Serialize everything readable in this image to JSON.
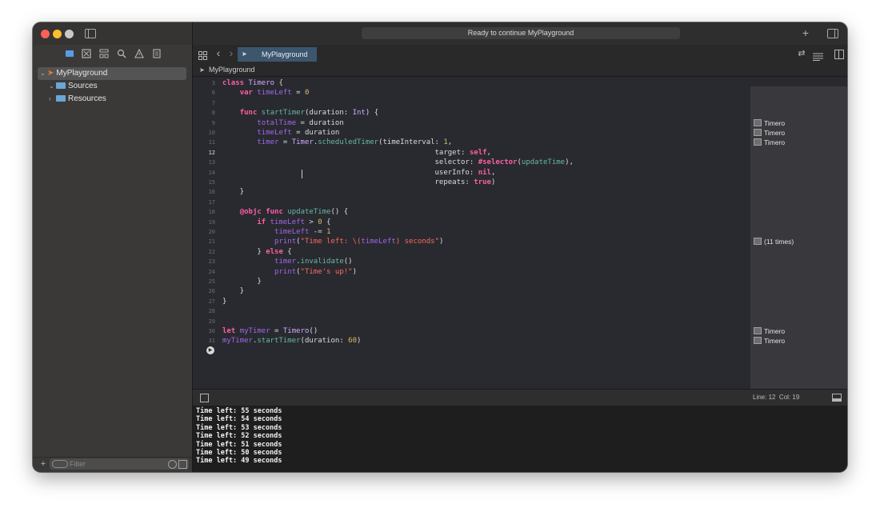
{
  "window": {
    "activity_status": "Ready to continue MyPlayground"
  },
  "sidebar": {
    "tree": [
      {
        "label": "MyPlayground",
        "chevron": "⌄"
      },
      {
        "label": "Sources",
        "chevron": "⌄"
      },
      {
        "label": "Resources",
        "chevron": "›"
      }
    ],
    "filter_placeholder": "Filter"
  },
  "tabbar": {
    "tab_label": "MyPlayground"
  },
  "jumpbar": {
    "file": "MyPlayground"
  },
  "editor": {
    "lines": [
      {
        "n": "3",
        "html": "<span class=\"kw\">class</span> <span class=\"ty\">Timero</span> {"
      },
      {
        "n": "6",
        "html": "    <span class=\"kw\">var</span> <span class=\"pr\">timeLeft</span> = <span class=\"num\">0</span>"
      },
      {
        "n": "7",
        "html": ""
      },
      {
        "n": "8",
        "html": "    <span class=\"kw\">func</span> <span class=\"fn\">startTimer</span>(duration: <span class=\"ty\">Int</span>) {"
      },
      {
        "n": "9",
        "html": "        <span class=\"pr\">totalTime</span> = duration"
      },
      {
        "n": "10",
        "html": "        <span class=\"pr\">timeLeft</span> = duration"
      },
      {
        "n": "11",
        "html": "        <span class=\"pr\">timer</span> = <span class=\"ty\">Timer</span>.<span class=\"fn\">scheduledTimer</span>(timeInterval: <span class=\"num\">1</span>,"
      },
      {
        "n": "12",
        "html": "                                                 target: <span class=\"kw\">self</span>,"
      },
      {
        "n": "13",
        "html": "                                                 selector: <span class=\"kw\">#selector</span>(<span class=\"fn\">updateTime</span>),"
      },
      {
        "n": "14",
        "html": "                                                 userInfo: <span class=\"kw\">nil</span>,"
      },
      {
        "n": "15",
        "html": "                                                 repeats: <span class=\"kw\">true</span>)"
      },
      {
        "n": "16",
        "html": "    }"
      },
      {
        "n": "17",
        "html": ""
      },
      {
        "n": "18",
        "html": "    <span class=\"kw\">@objc</span> <span class=\"kw\">func</span> <span class=\"fn\">updateTime</span>() {"
      },
      {
        "n": "19",
        "html": "        <span class=\"kw\">if</span> <span class=\"pr\">timeLeft</span> &gt; <span class=\"num\">0</span> {"
      },
      {
        "n": "20",
        "html": "            <span class=\"pr\">timeLeft</span> -= <span class=\"num\">1</span>"
      },
      {
        "n": "21",
        "html": "            <span class=\"pr\">print</span>(<span class=\"str\">\"Time left: \\(</span><span class=\"pr\">timeLeft</span><span class=\"str\">) seconds\"</span>)"
      },
      {
        "n": "22",
        "html": "        } <span class=\"kw\">else</span> {"
      },
      {
        "n": "23",
        "html": "            <span class=\"pr\">timer</span>.<span class=\"fn\">invalidate</span>()"
      },
      {
        "n": "24",
        "html": "            <span class=\"pr\">print</span>(<span class=\"str\">\"Time's up!\"</span>)"
      },
      {
        "n": "25",
        "html": "        }"
      },
      {
        "n": "26",
        "html": "    }"
      },
      {
        "n": "27",
        "html": "}"
      },
      {
        "n": "28",
        "html": ""
      },
      {
        "n": "29",
        "html": ""
      },
      {
        "n": "30",
        "html": "<span class=\"kw\">let</span> <span class=\"pr\">myTimer</span> = <span class=\"ty\">Timero</span>()"
      },
      {
        "n": "31",
        "html": "<span class=\"pr\">myTimer</span>.<span class=\"fn\">startTimer</span>(duration: <span class=\"num\">60</span>)"
      }
    ],
    "current_line": "12"
  },
  "results": [
    {
      "line": "9",
      "label": "Timero"
    },
    {
      "line": "10",
      "label": "Timero"
    },
    {
      "line": "11",
      "label": "Timero"
    },
    {
      "line": "21",
      "label": "(11 times)"
    },
    {
      "line": "30",
      "label": "Timero"
    },
    {
      "line": "31",
      "label": "Timero"
    }
  ],
  "debugbar": {
    "position": "Line: 12  Col: 19"
  },
  "console": {
    "lines": [
      "Time left: 55 seconds",
      "Time left: 54 seconds",
      "Time left: 53 seconds",
      "Time left: 52 seconds",
      "Time left: 51 seconds",
      "Time left: 50 seconds",
      "Time left: 49 seconds"
    ]
  },
  "icons": {
    "add": "+",
    "back": "‹",
    "forward": "›",
    "run": "▶"
  },
  "colors": {
    "traffic_close": "#ff5f57",
    "traffic_minimize": "#febc2e",
    "traffic_zoom": "#c9c9c9",
    "keyword": "#fc5fa3",
    "string": "#fc6a5d",
    "tab_active": "#3c566e"
  }
}
